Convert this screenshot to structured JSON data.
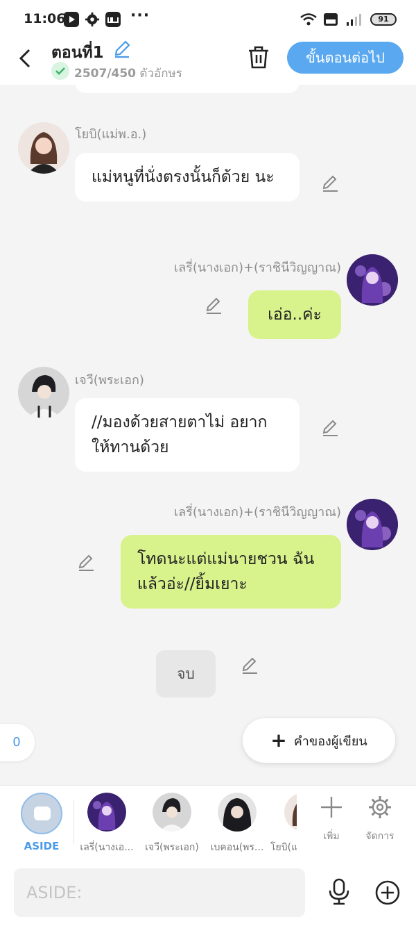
{
  "status": {
    "time": "11:06",
    "dots": "···",
    "battery": "91"
  },
  "header": {
    "title": "ตอนที่1",
    "count": "2507/450",
    "count_suffix": " ตัวอักษร",
    "next_label": "ขั้นตอนต่อไป"
  },
  "messages": [
    {
      "side": "left",
      "name": "โยบิ(แม่พ.อ.)",
      "text": "แม่หนูที่นั่งตรงนั้นก็ด้วย นะ"
    },
    {
      "side": "right",
      "name": "เลรี่(นางเอก)+(ราชินีวิญญาณ)",
      "text": "เอ่อ..ค่ะ"
    },
    {
      "side": "left",
      "name": "เจวี(พระเอก)",
      "text": "//มองด้วยสายตาไม่ อยากให้ทานด้วย"
    },
    {
      "side": "right",
      "name": "เลรี่(นางเอก)+(ราชินีวิญญาณ)",
      "text": "โทดนะแต่แม่นายชวน ฉันแล้วอ่ะ//ยิ้มเยาะ"
    }
  ],
  "end_label": "จบ",
  "side_count": "0",
  "author_note_label": "คำของผู้เขียน",
  "charbar": {
    "aside_label": "ASIDE",
    "characters": [
      {
        "label": "เลรี่(นางเอ..."
      },
      {
        "label": "เจวี(พระเอก)"
      },
      {
        "label": "เบคอน(พร..."
      },
      {
        "label": "โยบิ(แ"
      }
    ],
    "add_label": "เพิ่ม",
    "manage_label": "จัดการ"
  },
  "input": {
    "placeholder": "ASIDE:"
  },
  "colors": {
    "accent": "#5aa9f0",
    "right_bubble": "#d8f28c",
    "bg": "#f4f4f4"
  }
}
